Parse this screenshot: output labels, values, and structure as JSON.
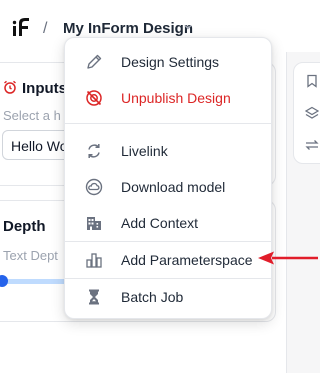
{
  "header": {
    "logo_icon": "inform-logo-icon",
    "separator": "/",
    "design_title": "My InForm Design"
  },
  "inputs_panel": {
    "title": "Inputs",
    "icon": "alarm-clock-icon",
    "hint": "Select a h",
    "text_value": "Hello Wo"
  },
  "depth_panel": {
    "title": "Depth",
    "hint": "Text Dept"
  },
  "menu": {
    "items": [
      {
        "label": "Design Settings",
        "icon": "pencil-icon"
      },
      {
        "label": "Unpublish Design",
        "icon": "broadcast-off-icon",
        "color": "#dc2626"
      },
      {
        "label": "Livelink",
        "icon": "sync-arrows-icon"
      },
      {
        "label": "Download model",
        "icon": "cloud-download-icon"
      },
      {
        "label": "Add Context",
        "icon": "buildings-icon"
      },
      {
        "label": "Add Parameterspace",
        "icon": "bar-chart-icon"
      },
      {
        "label": "Batch Job",
        "icon": "hourglass-icon"
      }
    ]
  },
  "colors": {
    "accent": "#2563eb",
    "danger": "#dc2626",
    "arrow": "#e11d2a"
  }
}
